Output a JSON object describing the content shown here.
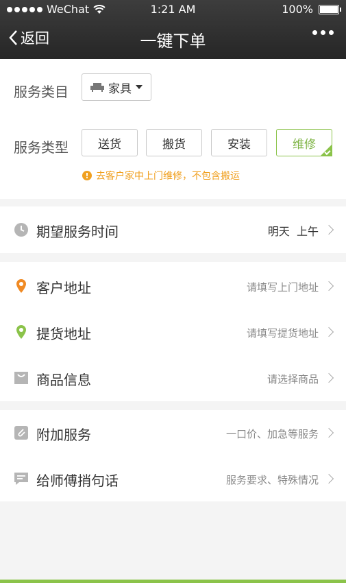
{
  "status_bar": {
    "carrier": "WeChat",
    "time": "1:21 AM",
    "battery": "100%"
  },
  "nav": {
    "back_label": "返回",
    "title": "一键下单"
  },
  "service_category": {
    "label": "服务类目",
    "selected": "家具"
  },
  "service_type": {
    "label": "服务类型",
    "options": [
      "送货",
      "搬货",
      "安装",
      "维修"
    ],
    "selected": "维修",
    "hint": "去客户家中上门维修，不包含搬运"
  },
  "time_row": {
    "title": "期望服务时间",
    "value": "明天  上午"
  },
  "address_rows": [
    {
      "title": "客户地址",
      "value": "请填写上门地址"
    },
    {
      "title": "提货地址",
      "value": "请填写提货地址"
    },
    {
      "title": "商品信息",
      "value": "请选择商品"
    }
  ],
  "extra_rows": [
    {
      "title": "附加服务",
      "value": "一口价、加急等服务"
    },
    {
      "title": "给师傅捎句话",
      "value": "服务要求、特殊情况"
    }
  ],
  "colors": {
    "accent": "#8bc34a",
    "warning": "#f0a020",
    "location_orange": "#f08a24",
    "location_green": "#8bc34a",
    "header": "#2e2e2e"
  }
}
